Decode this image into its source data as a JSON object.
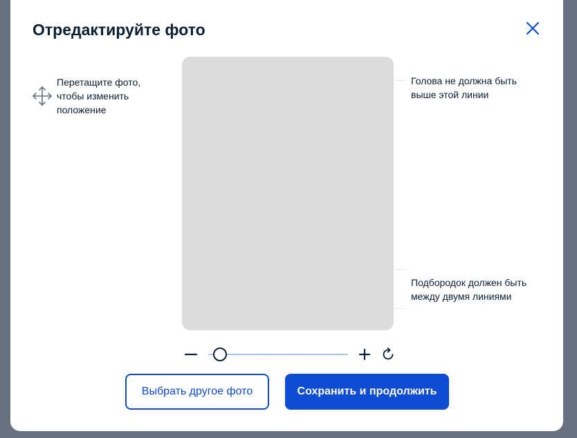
{
  "modal": {
    "title": "Отредактируйте фото"
  },
  "hints": {
    "drag": "Перетащите фото, чтобы изменить положение",
    "head": "Голова не должна быть выше этой линии",
    "chin": "Подбородок должен быть между двумя линиями"
  },
  "icons": {
    "close": "close-icon",
    "move": "move-icon",
    "minus": "minus-icon",
    "plus": "plus-icon",
    "rotate": "rotate-icon"
  },
  "zoom": {
    "level": 0.04
  },
  "buttons": {
    "choose_other": "Выбрать другое фото",
    "save_continue": "Сохранить и продолжить"
  },
  "colors": {
    "primary": "#0d4cd3",
    "text": "#0b1f33",
    "photo_placeholder": "#dcdcdc",
    "backdrop": "#66727f"
  }
}
